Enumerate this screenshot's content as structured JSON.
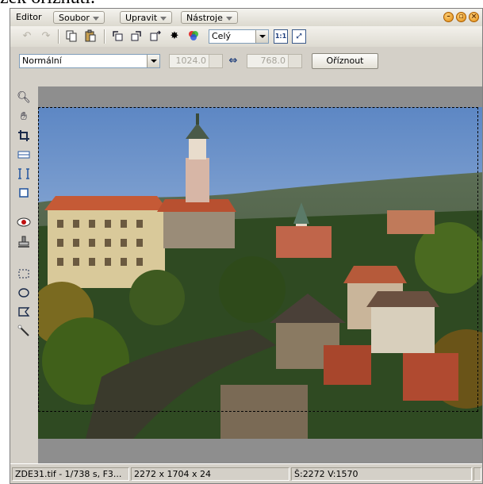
{
  "background_text": "zek oříznutí.",
  "window": {
    "title": "Editor",
    "menus": [
      {
        "label": "Soubor"
      },
      {
        "label": "Upravit"
      },
      {
        "label": "Nástroje"
      }
    ]
  },
  "toolbar1": {
    "zoom_select": "Celý",
    "actual_size_label": "1:1"
  },
  "toolbar2": {
    "mode_select": "Normální",
    "width_value": "1024.0",
    "height_value": "768.0",
    "crop_button": "Oříznout"
  },
  "status": {
    "file_info": "ZDE31.tif - 1/738 s, F3...",
    "dimensions": "2272 x 1704 x 24",
    "size_info": "Š:2272  V:1570"
  },
  "colors": {
    "window_bg": "#d4d0c8",
    "canvas_bg": "#8e8e8e",
    "accent_orange": "#e08a10"
  }
}
